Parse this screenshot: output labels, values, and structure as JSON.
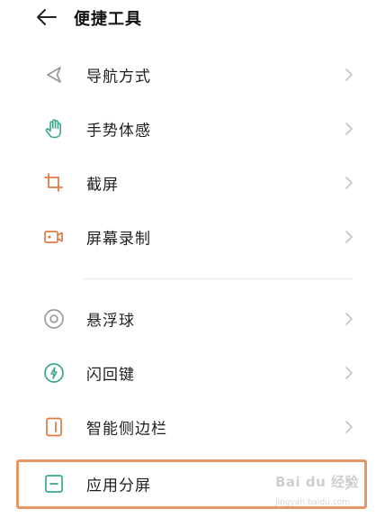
{
  "header": {
    "title": "便捷工具"
  },
  "items": [
    {
      "label": "导航方式"
    },
    {
      "label": "手势体感"
    },
    {
      "label": "截屏"
    },
    {
      "label": "屏幕录制"
    },
    {
      "label": "悬浮球"
    },
    {
      "label": "闪回键"
    },
    {
      "label": "智能侧边栏"
    },
    {
      "label": "应用分屏"
    }
  ],
  "watermark": {
    "main": "Bai du 经验",
    "sub": "jingyan.baidu.com"
  },
  "colors": {
    "highlight": "#e8956a",
    "icon_green": "#3aa58f",
    "icon_orange": "#e07a44",
    "icon_gray": "#9a9a9a"
  }
}
